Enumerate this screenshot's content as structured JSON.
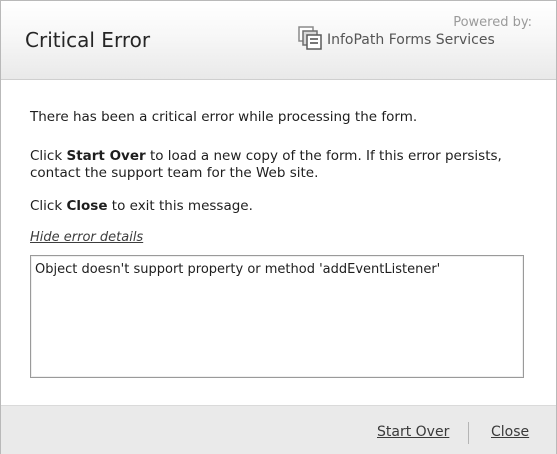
{
  "dialog": {
    "title": "Critical Error",
    "powered_by": "Powered by:",
    "brand": "InfoPath Forms Services",
    "message": "There has been a critical error while processing the form.",
    "startover_prefix": "Click ",
    "startover_bold": "Start Over",
    "startover_suffix": " to load a new copy of the form. If this error persists, contact the support team for the Web site.",
    "close_prefix": "Click ",
    "close_bold": "Close",
    "close_suffix": " to exit this message.",
    "hide_details_link": "Hide error details",
    "error_details": "Object doesn't support property or method 'addEventListener'"
  },
  "footer": {
    "start_over_label": "Start Over",
    "close_label": "Close"
  },
  "icons": {
    "brand_logo": "infopath-logo-icon"
  }
}
